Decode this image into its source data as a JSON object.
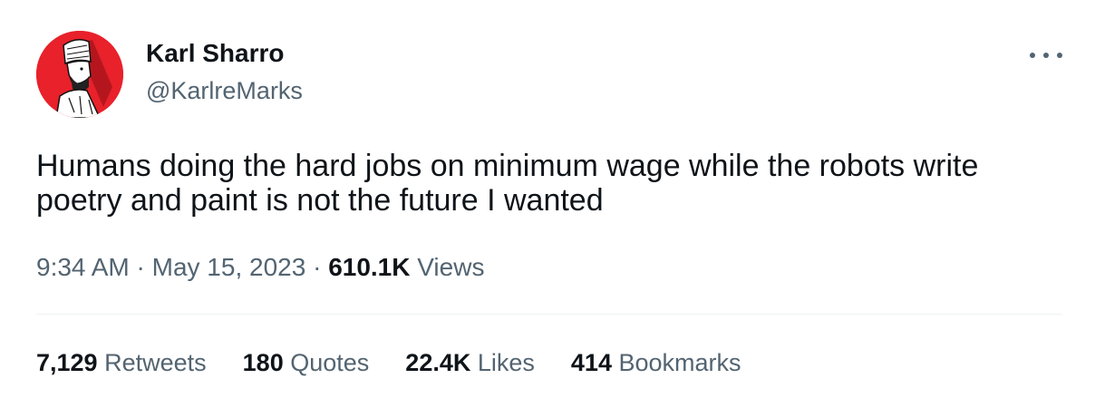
{
  "author": {
    "display_name": "Karl Sharro",
    "handle": "@KarlreMarks",
    "avatar_icon": "illustrated-man-portrait-icon",
    "avatar_bg_color": "#e8212a"
  },
  "tweet": {
    "text": "Humans doing the hard jobs on minimum wage while the robots write poetry and paint is not the future I wanted"
  },
  "meta": {
    "time": "9:34 AM",
    "separator": "·",
    "date": "May 15, 2023",
    "views_count": "610.1K",
    "views_label": "Views"
  },
  "stats": {
    "retweets": {
      "count": "7,129",
      "label": "Retweets"
    },
    "quotes": {
      "count": "180",
      "label": "Quotes"
    },
    "likes": {
      "count": "22.4K",
      "label": "Likes"
    },
    "bookmarks": {
      "count": "414",
      "label": "Bookmarks"
    }
  },
  "icons": {
    "more": "more-horizontal-icon"
  },
  "colors": {
    "text_primary": "#0f1419",
    "text_secondary": "#536471",
    "divider": "#eff3f4"
  }
}
